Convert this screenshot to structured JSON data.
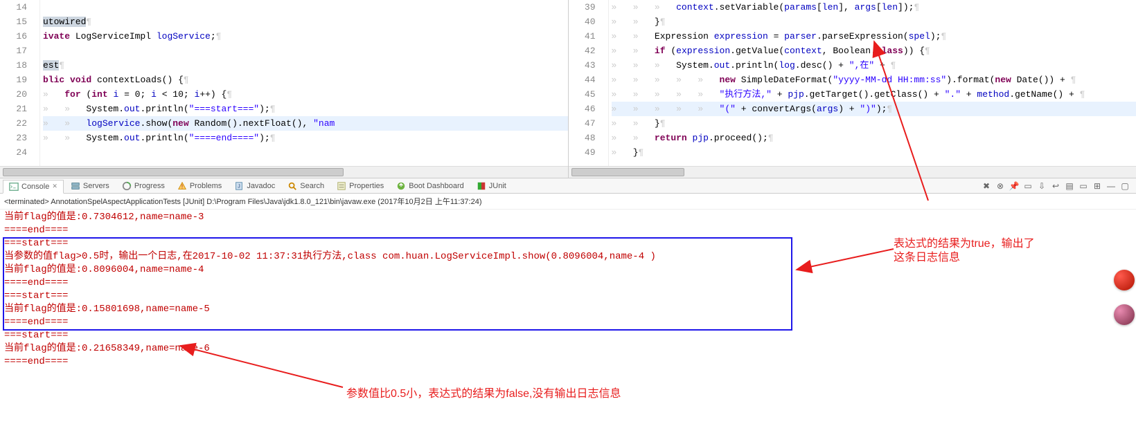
{
  "leftEditor": {
    "lines": [
      {
        "n": 14,
        "html": ""
      },
      {
        "n": 15,
        "html": "<span class='selmark'>utowired</span><span class='ws'>¶</span>"
      },
      {
        "n": 16,
        "html": "<span class='kw'>ivate</span> LogServiceImpl <span class='fld'>logService</span>;<span class='ws'>¶</span>"
      },
      {
        "n": 17,
        "html": ""
      },
      {
        "n": 18,
        "html": "<span class='selmark'>est</span><span class='ws'>¶</span>"
      },
      {
        "n": 19,
        "html": "<span class='kw'>blic</span> <span class='kw'>void</span> contextLoads() {<span class='ws'>¶</span>"
      },
      {
        "n": 20,
        "html": "<span class='ws'>»   </span><span class='kw'>for</span> (<span class='kw'>int</span> <span class='fld'>i</span> = 0; <span class='fld'>i</span> &lt; 10; <span class='fld'>i</span>++) {<span class='ws'>¶</span>"
      },
      {
        "n": 21,
        "html": "<span class='ws'>»   »   </span>System.<span class='fld'>out</span>.println(<span class='str'>\"===start===\"</span>);<span class='ws'>¶</span>"
      },
      {
        "n": 22,
        "hl": true,
        "html": "<span class='ws'>»   »   </span><span class='fld'>logService</span>.show(<span class='kw'>new</span> Random().nextFloat(), <span class='str'>\"nam</span>"
      },
      {
        "n": 23,
        "html": "<span class='ws'>»   »   </span>System.<span class='fld'>out</span>.println(<span class='str'>\"====end====\"</span>);<span class='ws'>¶</span>"
      },
      {
        "n": 24,
        "html": ""
      }
    ]
  },
  "rightEditor": {
    "lines": [
      {
        "n": 39,
        "html": "<span class='ws'>»   »   »   </span><span class='fld'>context</span>.setVariable(<span class='fld'>params</span>[<span class='fld'>len</span>], <span class='fld'>args</span>[<span class='fld'>len</span>]);<span class='ws'>¶</span>"
      },
      {
        "n": 40,
        "html": "<span class='ws'>»   »   </span>}<span class='ws'>¶</span>"
      },
      {
        "n": 41,
        "html": "<span class='ws'>»   »   </span>Expression <span class='fld'>expression</span> = <span class='fld'>parser</span>.parseExpression(<span class='fld'>spel</span>);<span class='ws'>¶</span>"
      },
      {
        "n": 42,
        "html": "<span class='ws'>»   »   </span><span class='kw'>if</span> (<span class='fld'>expression</span>.getValue(<span class='fld'>context</span>, Boolean.<span class='kw'>class</span>)) {<span class='ws'>¶</span>"
      },
      {
        "n": 43,
        "html": "<span class='ws'>»   »   »   </span>System.<span class='fld'>out</span>.println(<span class='fld'>log</span>.desc() + <span class='str'>\",在\"</span> + <span class='ws'>¶</span>"
      },
      {
        "n": 44,
        "html": "<span class='ws'>»   »   »   »   »   </span><span class='kw'>new</span> SimpleDateFormat(<span class='str'>\"yyyy-MM-dd HH:mm:ss\"</span>).format(<span class='kw'>new</span> Date()) + <span class='ws'>¶</span>"
      },
      {
        "n": 45,
        "html": "<span class='ws'>»   »   »   »   »   </span><span class='str'>\"执行方法,\"</span> + <span class='fld'>pjp</span>.getTarget().getClass() + <span class='str'>\".\"</span> + <span class='fld'>method</span>.getName() + <span class='ws'>¶</span>"
      },
      {
        "n": 46,
        "hl": true,
        "html": "<span class='ws'>»   »   »   »   »   </span><span class='str'>\"(\"</span> + convertArgs(<span class='fld'>args</span>) + <span class='str'>\")\"</span>);<span class='ws'>¶</span>"
      },
      {
        "n": 47,
        "html": "<span class='ws'>»   »   </span>}<span class='ws'>¶</span>"
      },
      {
        "n": 48,
        "html": "<span class='ws'>»   »   </span><span class='kw'>return</span> <span class='fld'>pjp</span>.proceed();<span class='ws'>¶</span>"
      },
      {
        "n": 49,
        "html": "<span class='ws'>»   </span>}<span class='ws'>¶</span>"
      }
    ]
  },
  "tabs": [
    {
      "id": "console",
      "label": "Console",
      "active": true
    },
    {
      "id": "servers",
      "label": "Servers"
    },
    {
      "id": "progress",
      "label": "Progress"
    },
    {
      "id": "problems",
      "label": "Problems"
    },
    {
      "id": "javadoc",
      "label": "Javadoc"
    },
    {
      "id": "search",
      "label": "Search"
    },
    {
      "id": "properties",
      "label": "Properties"
    },
    {
      "id": "boot",
      "label": "Boot Dashboard"
    },
    {
      "id": "junit",
      "label": "JUnit"
    }
  ],
  "terminated": "<terminated> AnnotationSpelAspectApplicationTests [JUnit] D:\\Program Files\\Java\\jdk1.8.0_121\\bin\\javaw.exe (2017年10月2日 上午11:37:24)",
  "consoleLines": [
    "当前flag的值是:0.7304612,name=name-3",
    "====end====",
    "===start===",
    "当参数的值flag>0.5时，输出一个日志,在2017-10-02 11:37:31执行方法,class com.huan.LogServiceImpl.show(0.8096004,name-4 )",
    "当前flag的值是:0.8096004,name=name-4",
    "====end====",
    "===start===",
    "当前flag的值是:0.15801698,name=name-5",
    "====end====",
    "===start===",
    "当前flag的值是:0.21658349,name=name-6",
    "====end===="
  ],
  "annotations": {
    "right1": "表达式的结果为true，输出了",
    "right2": "这条日志信息",
    "bottom": "参数值比0.5小，表达式的结果为false,没有输出日志信息"
  },
  "toolbarIcons": [
    "remove-launch",
    "remove-all",
    "pin",
    "display",
    "scroll-lock",
    "word-wrap",
    "open-console",
    "clear",
    "toggle",
    "min",
    "max"
  ]
}
